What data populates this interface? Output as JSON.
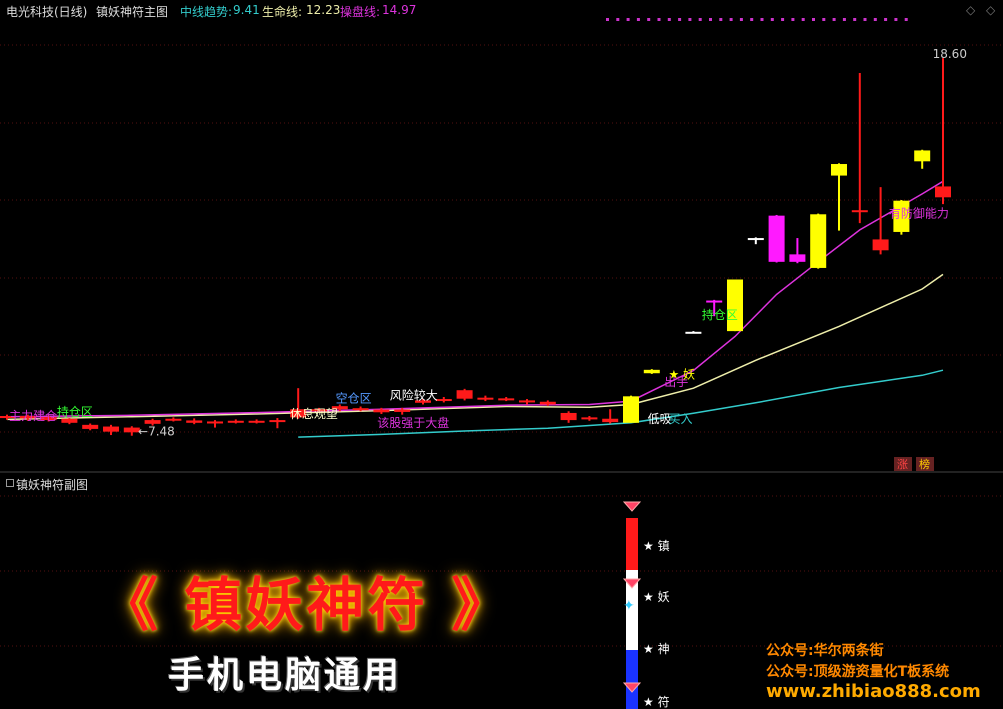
{
  "header": {
    "security": "电光科技(日线)",
    "indicator": "镇妖神符主图",
    "mid_label": "中线趋势:",
    "mid_value": "9.41",
    "life_label": "生命线:",
    "life_value": "12.23",
    "op_label": "操盘线:",
    "op_value": "14.97"
  },
  "sub_panel": {
    "title": "镇妖神符副图"
  },
  "controls": {
    "up": "◇",
    "down": "◇"
  },
  "colors": {
    "up": "#ff1a1a",
    "down": "#ff1a1a",
    "yellow": "#ffff00",
    "magenta": "#ff1aff",
    "mid_line": "#33cccc",
    "life_line": "#eeeeaa",
    "op_line": "#dd33dd"
  },
  "chart_data": {
    "type": "candlestick",
    "ylim": [
      6.5,
      19.5
    ],
    "x_count": 46,
    "candles": [
      {
        "o": 8.0,
        "c": 8.06,
        "h": 8.1,
        "l": 7.95,
        "color": "red"
      },
      {
        "o": 7.99,
        "c": 8.06,
        "h": 8.1,
        "l": 7.92,
        "color": "red"
      },
      {
        "o": 8.03,
        "c": 7.94,
        "h": 8.08,
        "l": 7.9,
        "color": "red"
      },
      {
        "o": 7.98,
        "c": 7.86,
        "h": 8.0,
        "l": 7.82,
        "color": "red"
      },
      {
        "o": 7.8,
        "c": 7.68,
        "h": 7.84,
        "l": 7.64,
        "color": "red"
      },
      {
        "o": 7.75,
        "c": 7.6,
        "h": 7.8,
        "l": 7.5,
        "color": "red"
      },
      {
        "o": 7.72,
        "c": 7.58,
        "h": 7.76,
        "l": 7.48,
        "color": "red"
      },
      {
        "o": 7.83,
        "c": 7.94,
        "h": 7.98,
        "l": 7.78,
        "color": "red"
      },
      {
        "o": 7.94,
        "c": 7.98,
        "h": 8.02,
        "l": 7.9,
        "color": "red"
      },
      {
        "o": 7.93,
        "c": 7.86,
        "h": 7.99,
        "l": 7.82,
        "color": "red"
      },
      {
        "o": 7.9,
        "c": 7.84,
        "h": 7.94,
        "l": 7.72,
        "color": "red"
      },
      {
        "o": 7.88,
        "c": 7.92,
        "h": 7.96,
        "l": 7.84,
        "color": "red"
      },
      {
        "o": 7.92,
        "c": 7.88,
        "h": 7.96,
        "l": 7.84,
        "color": "red"
      },
      {
        "o": 7.9,
        "c": 7.94,
        "h": 8.0,
        "l": 7.7,
        "color": "red"
      },
      {
        "o": 8.02,
        "c": 8.26,
        "h": 8.88,
        "l": 7.98,
        "color": "red"
      },
      {
        "o": 8.26,
        "c": 8.23,
        "h": 8.3,
        "l": 8.2,
        "color": "red"
      },
      {
        "o": 8.26,
        "c": 8.35,
        "h": 8.4,
        "l": 8.2,
        "color": "red"
      },
      {
        "o": 8.29,
        "c": 8.25,
        "h": 8.34,
        "l": 8.2,
        "color": "red"
      },
      {
        "o": 8.25,
        "c": 8.17,
        "h": 8.3,
        "l": 8.12,
        "color": "red"
      },
      {
        "o": 8.18,
        "c": 8.25,
        "h": 8.3,
        "l": 8.1,
        "color": "red"
      },
      {
        "o": 8.45,
        "c": 8.52,
        "h": 8.56,
        "l": 8.4,
        "color": "red"
      },
      {
        "o": 8.52,
        "c": 8.56,
        "h": 8.62,
        "l": 8.46,
        "color": "red"
      },
      {
        "o": 8.57,
        "c": 8.82,
        "h": 8.86,
        "l": 8.52,
        "color": "red"
      },
      {
        "o": 8.56,
        "c": 8.6,
        "h": 8.66,
        "l": 8.5,
        "color": "red"
      },
      {
        "o": 8.58,
        "c": 8.54,
        "h": 8.62,
        "l": 8.5,
        "color": "red"
      },
      {
        "o": 8.52,
        "c": 8.46,
        "h": 8.56,
        "l": 8.4,
        "color": "red"
      },
      {
        "o": 8.48,
        "c": 8.4,
        "h": 8.52,
        "l": 8.36,
        "color": "red"
      },
      {
        "o": 8.15,
        "c": 7.94,
        "h": 8.2,
        "l": 7.86,
        "color": "red"
      },
      {
        "o": 7.98,
        "c": 8.02,
        "h": 8.06,
        "l": 7.92,
        "color": "red"
      },
      {
        "o": 7.98,
        "c": 7.88,
        "h": 8.26,
        "l": 7.84,
        "color": "red"
      },
      {
        "o": 7.86,
        "c": 8.64,
        "h": 8.66,
        "l": 7.86,
        "color": "yellow"
      },
      {
        "o": 9.42,
        "c": 9.32,
        "h": 9.44,
        "l": 9.3,
        "color": "yellow"
      },
      null,
      {
        "o": 10.54,
        "c": 10.54,
        "h": 10.56,
        "l": 10.52,
        "color": "white"
      },
      {
        "o": 11.46,
        "c": 11.46,
        "h": 11.48,
        "l": 11.0,
        "color": "magenta"
      },
      {
        "o": 10.56,
        "c": 12.08,
        "h": 12.08,
        "l": 10.56,
        "color": "yellow"
      },
      {
        "o": 13.3,
        "c": 13.3,
        "h": 13.32,
        "l": 13.12,
        "color": "white"
      },
      {
        "o": 13.96,
        "c": 12.6,
        "h": 13.98,
        "l": 12.58,
        "color": "magenta"
      },
      {
        "o": 12.6,
        "c": 12.82,
        "h": 13.3,
        "l": 12.56,
        "color": "magenta"
      },
      {
        "o": 12.42,
        "c": 14.0,
        "h": 14.02,
        "l": 12.4,
        "color": "yellow"
      },
      {
        "o": 15.14,
        "c": 15.48,
        "h": 15.5,
        "l": 13.52,
        "color": "yellow"
      },
      {
        "o": 14.12,
        "c": 14.12,
        "h": 18.16,
        "l": 13.74,
        "color": "red"
      },
      {
        "o": 13.26,
        "c": 12.94,
        "h": 14.8,
        "l": 12.82,
        "color": "red"
      },
      {
        "o": 13.48,
        "c": 14.4,
        "h": 14.42,
        "l": 13.4,
        "color": "yellow"
      },
      {
        "o": 15.56,
        "c": 15.88,
        "h": 15.9,
        "l": 15.34,
        "color": "yellow"
      },
      {
        "o": 14.5,
        "c": 14.82,
        "h": 18.6,
        "l": 14.3,
        "color": "red"
      }
    ],
    "lines": {
      "mid_trend": [
        [
          14,
          7.44
        ],
        [
          18,
          7.52
        ],
        [
          22,
          7.62
        ],
        [
          26,
          7.7
        ],
        [
          30,
          7.86
        ],
        [
          33,
          8.14
        ],
        [
          36,
          8.45
        ],
        [
          40,
          8.9
        ],
        [
          44,
          9.26
        ],
        [
          45,
          9.41
        ]
      ],
      "life_line": [
        [
          0,
          7.96
        ],
        [
          6,
          8.04
        ],
        [
          12,
          8.12
        ],
        [
          18,
          8.22
        ],
        [
          24,
          8.34
        ],
        [
          28,
          8.32
        ],
        [
          30,
          8.4
        ],
        [
          33,
          8.88
        ],
        [
          36,
          9.7
        ],
        [
          40,
          10.7
        ],
        [
          44,
          11.8
        ],
        [
          45,
          12.23
        ]
      ],
      "op_line": [
        [
          0,
          8.04
        ],
        [
          6,
          8.08
        ],
        [
          12,
          8.16
        ],
        [
          18,
          8.26
        ],
        [
          24,
          8.38
        ],
        [
          28,
          8.4
        ],
        [
          30,
          8.5
        ],
        [
          33,
          9.4
        ],
        [
          35,
          10.4
        ],
        [
          37,
          11.64
        ],
        [
          39,
          12.6
        ],
        [
          41,
          13.54
        ],
        [
          44,
          14.6
        ],
        [
          45,
          14.97
        ]
      ]
    },
    "annotations": [
      {
        "text": "18.60",
        "x": 44.5,
        "y": 18.6,
        "color": "#cccccc"
      },
      {
        "text": "←7.48",
        "x": 6.3,
        "y": 7.48,
        "color": "#cccccc"
      },
      {
        "text": "持仓区",
        "x": 2.4,
        "y": 8.06,
        "color": "#33ff33"
      },
      {
        "text": "主力建仓",
        "x": 0.1,
        "y": 7.94,
        "color": "#dd33dd"
      },
      {
        "text": "休息观望",
        "x": 13.6,
        "y": 8.0,
        "color": "#ffffcc"
      },
      {
        "text": "空仓区",
        "x": 15.8,
        "y": 8.46,
        "color": "#5599ff"
      },
      {
        "text": "风险较大",
        "x": 18.4,
        "y": 8.54,
        "color": "#ffffff"
      },
      {
        "text": "该股强于大盘",
        "x": 17.8,
        "y": 7.74,
        "color": "#dd33dd"
      },
      {
        "text": "出手",
        "x": 31.6,
        "y": 8.94,
        "color": "#dd33dd"
      },
      {
        "text": "★ 妖",
        "x": 31.8,
        "y": 9.16,
        "color": "#ffff00"
      },
      {
        "text": "低吸",
        "x": 30.8,
        "y": 7.86,
        "color": "#ffffff"
      },
      {
        "text": "买入",
        "x": 31.8,
        "y": 7.86,
        "color": "#33cccc"
      },
      {
        "text": "持仓区",
        "x": 33.4,
        "y": 10.92,
        "color": "#33ff33"
      },
      {
        "text": "有防御能力",
        "x": 42.4,
        "y": 13.9,
        "color": "#dd33dd"
      }
    ],
    "badges": [
      {
        "text": "涨",
        "bg": "#662222",
        "fg": "#ff4444"
      },
      {
        "text": "榜",
        "bg": "#662222",
        "fg": "#ffcc00"
      }
    ],
    "sub_bars": [
      {
        "label": "★ 镇",
        "color": "#ff1a1a"
      },
      {
        "label": "★ 妖",
        "color": "#ffffff"
      },
      {
        "label": "★ 神",
        "color": "#ffffff"
      },
      {
        "label": "★ 符",
        "color": "#1a33ff"
      }
    ]
  },
  "promo": {
    "title": "《 镇妖神符 》",
    "subtitle": "手机电脑通用",
    "wechat1": "公众号:华尔两条街",
    "wechat2": "公众号:顶级游资量化T板系统",
    "site": "www.zhibiao888.com"
  }
}
